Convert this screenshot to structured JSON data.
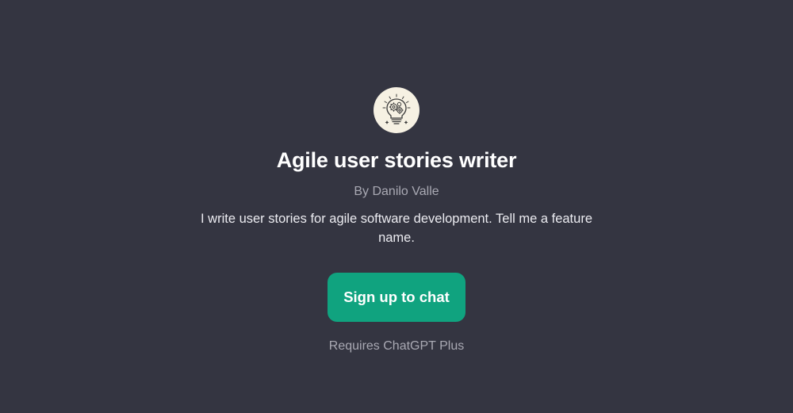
{
  "gpt": {
    "avatar_icon": "lightbulb-gears-icon",
    "title": "Agile user stories writer",
    "author": "By Danilo Valle",
    "description": "I write user stories for agile software development. Tell me a feature name."
  },
  "cta": {
    "label": "Sign up to chat"
  },
  "requirement": "Requires ChatGPT Plus",
  "colors": {
    "background": "#343541",
    "button": "#10a37f",
    "avatar_bg": "#f6f1e3"
  }
}
